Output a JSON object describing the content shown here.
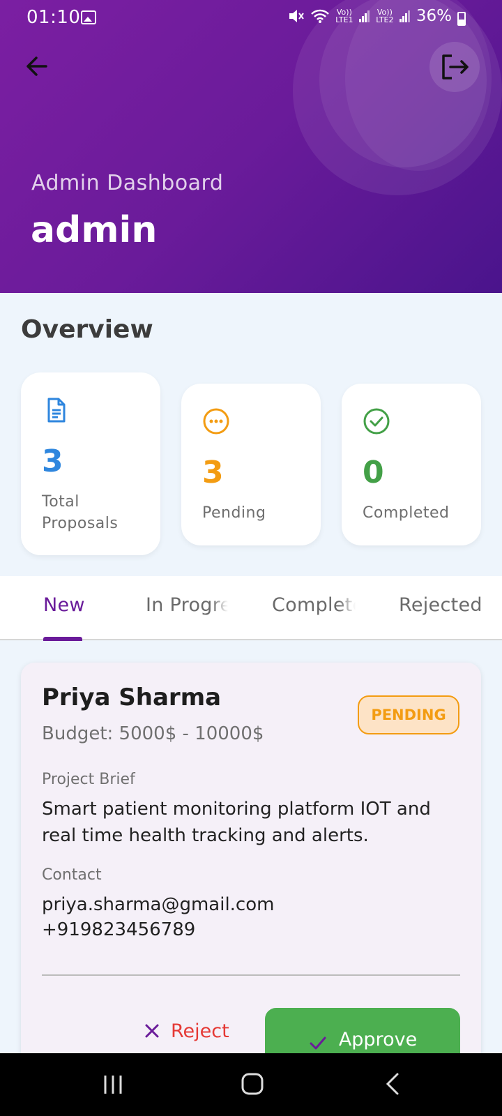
{
  "status_bar": {
    "time": "01:10",
    "battery": "36%",
    "sim1": "Vo)) LTE1",
    "sim2": "Vo)) LTE2"
  },
  "header": {
    "subtitle": "Admin Dashboard",
    "user_name": "admin"
  },
  "overview": {
    "title": "Overview",
    "stats": [
      {
        "value": "3",
        "label": "Total Proposals",
        "icon": "document-icon",
        "color": "#2e86de"
      },
      {
        "value": "3",
        "label": "Pending",
        "icon": "more-horizontal-circle-icon",
        "color": "#f39c12"
      },
      {
        "value": "0",
        "label": "Completed",
        "icon": "check-circle-icon",
        "color": "#43a047"
      }
    ]
  },
  "tabs": [
    {
      "label": "New",
      "active": true
    },
    {
      "label": "In Progress",
      "active": false
    },
    {
      "label": "Completed",
      "active": false
    },
    {
      "label": "Rejected",
      "active": false
    }
  ],
  "proposal": {
    "name": "Priya Sharma",
    "budget": "Budget: 5000$ - 10000$",
    "status": "PENDING",
    "brief_label": "Project Brief",
    "brief": "Smart patient monitoring platform IOT and real time health tracking and alerts.",
    "contact_label": "Contact",
    "email": "priya.sharma@gmail.com",
    "phone": "+919823456789",
    "reject_label": "Reject",
    "approve_label": "Approve"
  },
  "colors": {
    "primary": "#6a1b9a",
    "pending": "#f39c12",
    "approve": "#4caf50",
    "reject": "#e53935"
  }
}
